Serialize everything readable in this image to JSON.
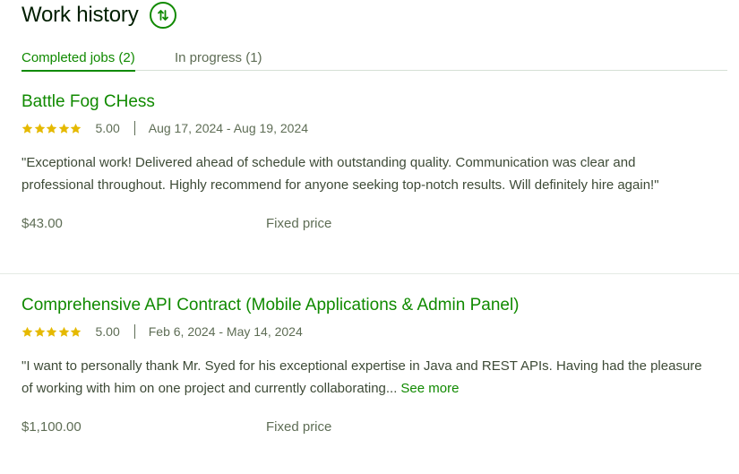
{
  "header": {
    "title": "Work history",
    "sort_icon": "sort-arrows-icon"
  },
  "tabs": [
    {
      "label": "Completed jobs (2)",
      "active": true
    },
    {
      "label": "In progress (1)",
      "active": false
    }
  ],
  "jobs": [
    {
      "title": "Battle Fog CHess",
      "stars": 5,
      "rating": "5.00",
      "dates": "Aug 17, 2024 - Aug 19, 2024",
      "feedback": "\"Exceptional work! Delivered ahead of schedule with outstanding quality. Communication was clear and professional throughout. Highly recommend for anyone seeking top-notch results. Will definitely hire again!\"",
      "see_more": "",
      "price": "$43.00",
      "price_type": "Fixed price"
    },
    {
      "title": "Comprehensive API Contract (Mobile Applications & Admin Panel)",
      "stars": 5,
      "rating": "5.00",
      "dates": "Feb 6, 2024 - May 14, 2024",
      "feedback": "\"I want to personally thank Mr. Syed for his exceptional expertise in Java and REST APIs. Having had the pleasure of working with him on one project and currently collaborating...",
      "see_more": "See more",
      "price": "$1,100.00",
      "price_type": "Fixed price"
    }
  ],
  "colors": {
    "accent": "#108a00",
    "star": "#e5b900",
    "text": "#001e00",
    "muted": "#5e6d55"
  }
}
